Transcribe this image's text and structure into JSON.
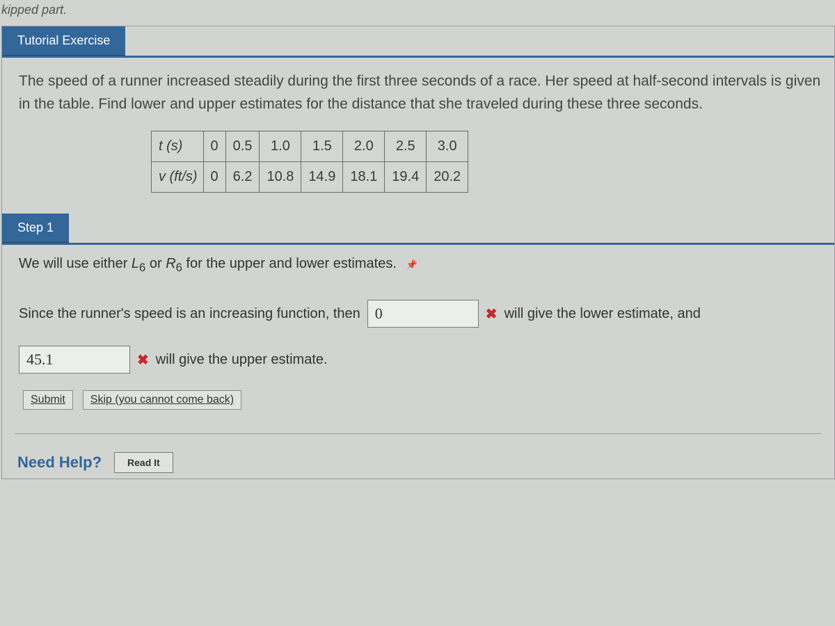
{
  "top_note": "kipped part.",
  "tutorial": {
    "header": "Tutorial Exercise",
    "problem": "The speed of a runner increased steadily during the first three seconds of a race. Her speed at half-second intervals is given in the table. Find lower and upper estimates for the distance that she traveled during these three seconds.",
    "table": {
      "row1_label": "t (s)",
      "row1": [
        "0",
        "0.5",
        "1.0",
        "1.5",
        "2.0",
        "2.5",
        "3.0"
      ],
      "row2_label": "v (ft/s)",
      "row2": [
        "0",
        "6.2",
        "10.8",
        "14.9",
        "18.1",
        "19.4",
        "20.2"
      ]
    }
  },
  "step1": {
    "header": "Step 1",
    "intro_pre": "We will use either ",
    "intro_L": "L",
    "intro_sub6a": "6",
    "intro_or": " or ",
    "intro_R": "R",
    "intro_sub6b": "6",
    "intro_post": " for the upper and lower estimates.",
    "line2_pre": "Since the runner's speed is an increasing function, then",
    "input1_value": "0",
    "line2_post": "will give the lower estimate, and",
    "input2_value": "45.1",
    "line3_post": "will give the upper estimate.",
    "x_symbol": "✖",
    "pin": "📌"
  },
  "buttons": {
    "submit": "Submit",
    "skip": "Skip (you cannot come back)"
  },
  "help": {
    "label": "Need Help?",
    "readit": "Read It"
  }
}
